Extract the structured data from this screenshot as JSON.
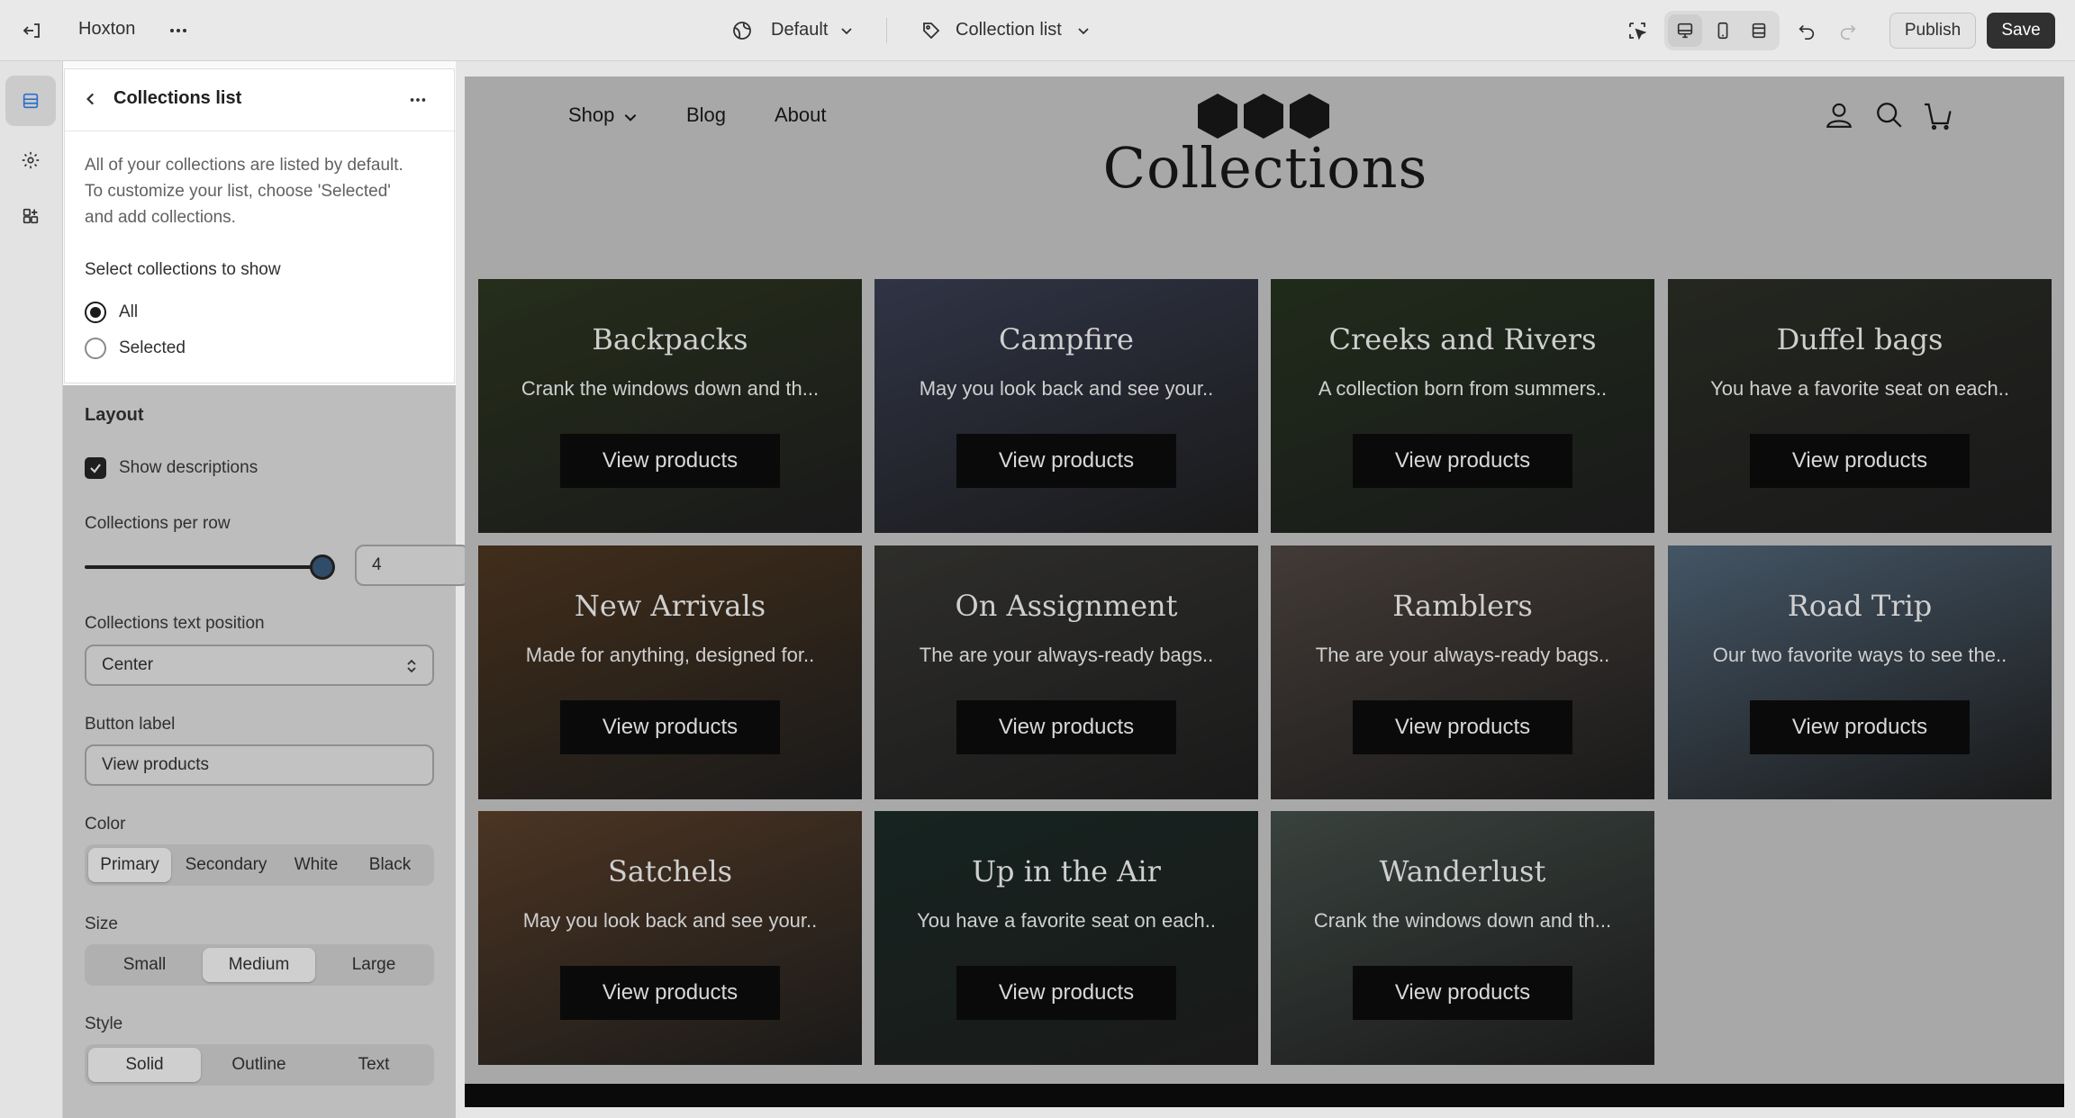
{
  "topbar": {
    "store_name": "Hoxton",
    "theme_selector": "Default",
    "template_selector": "Collection list",
    "publish_label": "Publish",
    "save_label": "Save"
  },
  "sidebar": {
    "title": "Collections list",
    "help_text_1": "All of your collections are listed by default.",
    "help_text_2": "To customize your list, choose 'Selected'",
    "help_text_3": "and add collections.",
    "select_label": "Select collections to show",
    "options": [
      "All",
      "Selected"
    ],
    "selected_option": "All",
    "layout_heading": "Layout",
    "show_descriptions_label": "Show descriptions",
    "show_descriptions_checked": true,
    "per_row_label": "Collections per row",
    "per_row_value": "4",
    "per_row_fraction": 1.0,
    "text_position_label": "Collections text position",
    "text_position_value": "Center",
    "button_label_label": "Button label",
    "button_label_value": "View products",
    "color_label": "Color",
    "color_options": [
      "Primary",
      "Secondary",
      "White",
      "Black"
    ],
    "color_selected": "Primary",
    "size_label": "Size",
    "size_options": [
      "Small",
      "Medium",
      "Large"
    ],
    "size_selected": "Medium",
    "style_label": "Style",
    "style_options": [
      "Solid",
      "Outline",
      "Text"
    ],
    "style_selected": "Solid"
  },
  "preview": {
    "nav": [
      "Shop",
      "Blog",
      "About"
    ],
    "page_title": "Collections",
    "button_text": "View products",
    "collections": [
      {
        "title": "Backpacks",
        "desc": "Crank the windows down and th...",
        "color": "#3d4a2c"
      },
      {
        "title": "Campfire",
        "desc": "May you look back and see your..",
        "color": "#4d5470"
      },
      {
        "title": "Creeks and Rivers",
        "desc": "A collection born from summers..",
        "color": "#34462a"
      },
      {
        "title": "Duffel bags",
        "desc": "You have a favorite seat on each..",
        "color": "#3b3f34"
      },
      {
        "title": "New Arrivals",
        "desc": "Made for anything, designed for..",
        "color": "#6a4a2c"
      },
      {
        "title": "On Assignment",
        "desc": "The are your always-ready bags..",
        "color": "#4b4a46"
      },
      {
        "title": "Ramblers",
        "desc": "The are your always-ready bags..",
        "color": "#6b5f58"
      },
      {
        "title": "Road Trip",
        "desc": "Our two favorite ways to see the..",
        "color": "#6e8aa4"
      },
      {
        "title": "Satchels",
        "desc": "May you look back and see your..",
        "color": "#7a5538"
      },
      {
        "title": "Up in the Air",
        "desc": "You have a favorite seat on each..",
        "color": "#243a34"
      },
      {
        "title": "Wanderlust",
        "desc": "Crank the windows down and th...",
        "color": "#5d6b64"
      }
    ]
  }
}
